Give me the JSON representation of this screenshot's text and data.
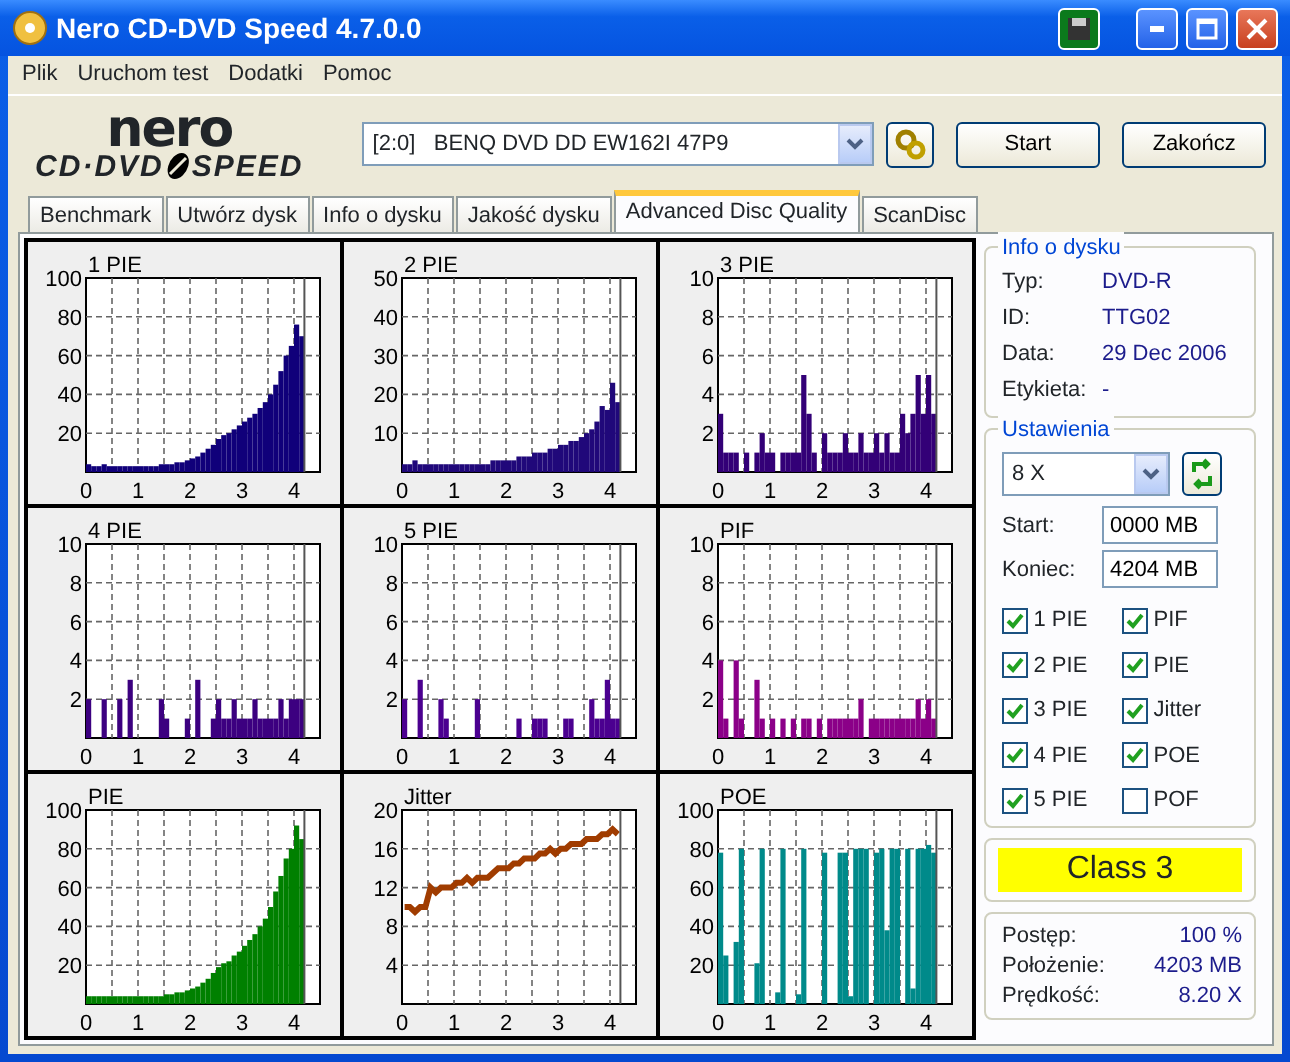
{
  "window": {
    "title": "Nero CD-DVD Speed 4.7.0.0"
  },
  "menu": [
    "Plik",
    "Uruchom test",
    "Dodatki",
    "Pomoc"
  ],
  "logo": {
    "top": "nero",
    "left": "CD·DVD",
    "right": "SPEED"
  },
  "toolbar": {
    "drive": "[2:0]   BENQ DVD DD EW162I 47P9",
    "buttons": [
      "Start",
      "Zakończ"
    ]
  },
  "tabs": [
    {
      "label": "Benchmark",
      "selected": false
    },
    {
      "label": "Utwórz dysk",
      "selected": false
    },
    {
      "label": "Info o dysku",
      "selected": false
    },
    {
      "label": "Jakość dysku",
      "selected": false
    },
    {
      "label": "Advanced Disc Quality",
      "selected": true
    },
    {
      "label": "ScanDisc",
      "selected": false
    }
  ],
  "charts": [
    {
      "chart_data": {
        "type": "bar",
        "grid": true,
        "ref_lines": [
          {
            "axis": "x",
            "value": 4.2
          }
        ],
        "x": [
          0,
          0.1,
          0.2,
          0.3,
          0.4,
          0.5,
          0.6,
          0.7,
          0.8,
          0.9,
          1,
          1.1,
          1.2,
          1.3,
          1.4,
          1.5,
          1.6,
          1.7,
          1.8,
          1.9,
          2,
          2.1,
          2.2,
          2.3,
          2.4,
          2.5,
          2.6,
          2.7,
          2.8,
          2.9,
          3,
          3.1,
          3.2,
          3.3,
          3.4,
          3.5,
          3.6,
          3.7,
          3.8,
          3.9,
          4,
          4.1
        ],
        "series": [
          {
            "name": "1 PIE",
            "color": "#10007a",
            "values": [
              4,
              3,
              3,
              4,
              3,
              3,
              3,
              3,
              3,
              3,
              3,
              3,
              3,
              3,
              4,
              4,
              4,
              5,
              5,
              6,
              7,
              8,
              10,
              12,
              14,
              17,
              19,
              20,
              22,
              24,
              26,
              28,
              30,
              33,
              36,
              40,
              45,
              52,
              60,
              65,
              76,
              70
            ]
          }
        ],
        "xlim": [
          0,
          4.5
        ],
        "ylim": [
          0,
          100
        ],
        "xticks": [
          0,
          1,
          2,
          3,
          4
        ],
        "yticks": [
          20,
          40,
          60,
          80,
          100
        ]
      }
    },
    {
      "chart_data": {
        "type": "bar",
        "grid": true,
        "ref_lines": [
          {
            "axis": "x",
            "value": 4.2
          }
        ],
        "x": [
          0,
          0.1,
          0.2,
          0.3,
          0.4,
          0.5,
          0.6,
          0.7,
          0.8,
          0.9,
          1,
          1.1,
          1.2,
          1.3,
          1.4,
          1.5,
          1.6,
          1.7,
          1.8,
          1.9,
          2,
          2.1,
          2.2,
          2.3,
          2.4,
          2.5,
          2.6,
          2.7,
          2.8,
          2.9,
          3,
          3.1,
          3.2,
          3.3,
          3.4,
          3.5,
          3.6,
          3.7,
          3.8,
          3.9,
          4,
          4.1
        ],
        "series": [
          {
            "name": "2 PIE",
            "color": "#20087a",
            "values": [
              2,
              2,
              3,
              2,
              2,
              2,
              2,
              2,
              2,
              2,
              2,
              2,
              2,
              2,
              2,
              2,
              2,
              3,
              3,
              3,
              3,
              3,
              4,
              4,
              4,
              5,
              5,
              5,
              6,
              6,
              7,
              7,
              8,
              8,
              9,
              10,
              11,
              13,
              17,
              16,
              23,
              18
            ]
          }
        ],
        "xlim": [
          0,
          4.5
        ],
        "ylim": [
          0,
          50
        ],
        "xticks": [
          0,
          1,
          2,
          3,
          4
        ],
        "yticks": [
          10,
          20,
          30,
          40,
          50
        ]
      }
    },
    {
      "chart_data": {
        "type": "bar",
        "grid": true,
        "ref_lines": [
          {
            "axis": "x",
            "value": 4.2
          }
        ],
        "x": [
          0,
          0.1,
          0.2,
          0.3,
          0.4,
          0.5,
          0.6,
          0.7,
          0.8,
          0.9,
          1,
          1.1,
          1.2,
          1.3,
          1.4,
          1.5,
          1.6,
          1.7,
          1.8,
          1.9,
          2,
          2.1,
          2.2,
          2.3,
          2.4,
          2.5,
          2.6,
          2.7,
          2.8,
          2.9,
          3,
          3.1,
          3.2,
          3.3,
          3.4,
          3.5,
          3.6,
          3.7,
          3.8,
          3.9,
          4,
          4.1
        ],
        "series": [
          {
            "name": "3 PIE",
            "color": "#330077",
            "values": [
              3,
              1,
              1,
              1,
              0,
              1,
              0,
              1,
              2,
              1,
              1,
              0,
              1,
              1,
              1,
              1,
              5,
              3,
              1,
              0,
              2,
              1,
              1,
              1,
              2,
              1,
              1,
              2,
              1,
              1,
              2,
              1,
              2,
              1,
              1,
              3,
              2,
              3,
              5,
              3,
              5,
              3
            ]
          }
        ],
        "xlim": [
          0,
          4.5
        ],
        "ylim": [
          0,
          10
        ],
        "xticks": [
          0,
          1,
          2,
          3,
          4
        ],
        "yticks": [
          2,
          4,
          6,
          8,
          10
        ]
      }
    },
    {
      "chart_data": {
        "type": "bar",
        "grid": true,
        "ref_lines": [
          {
            "axis": "x",
            "value": 4.2
          }
        ],
        "x": [
          0,
          0.1,
          0.2,
          0.3,
          0.4,
          0.5,
          0.6,
          0.7,
          0.8,
          0.9,
          1,
          1.1,
          1.2,
          1.3,
          1.4,
          1.5,
          1.6,
          1.7,
          1.8,
          1.9,
          2,
          2.1,
          2.2,
          2.3,
          2.4,
          2.5,
          2.6,
          2.7,
          2.8,
          2.9,
          3,
          3.1,
          3.2,
          3.3,
          3.4,
          3.5,
          3.6,
          3.7,
          3.8,
          3.9,
          4,
          4.1
        ],
        "series": [
          {
            "name": "4 PIE",
            "color": "#3c0080",
            "values": [
              2,
              0,
              0,
              2,
              0,
              0,
              2,
              0,
              3,
              0,
              0,
              0,
              0,
              0,
              2,
              1,
              0,
              0,
              0,
              1,
              0,
              3,
              0,
              0,
              1,
              2,
              1,
              1,
              2,
              1,
              1,
              1,
              2,
              1,
              1,
              1,
              1,
              2,
              1,
              2,
              2,
              2
            ]
          }
        ],
        "xlim": [
          0,
          4.5
        ],
        "ylim": [
          0,
          10
        ],
        "xticks": [
          0,
          1,
          2,
          3,
          4
        ],
        "yticks": [
          2,
          4,
          6,
          8,
          10
        ]
      }
    },
    {
      "chart_data": {
        "type": "bar",
        "grid": true,
        "ref_lines": [
          {
            "axis": "x",
            "value": 4.2
          }
        ],
        "x": [
          0,
          0.1,
          0.2,
          0.3,
          0.4,
          0.5,
          0.6,
          0.7,
          0.8,
          0.9,
          1,
          1.1,
          1.2,
          1.3,
          1.4,
          1.5,
          1.6,
          1.7,
          1.8,
          1.9,
          2,
          2.1,
          2.2,
          2.3,
          2.4,
          2.5,
          2.6,
          2.7,
          2.8,
          2.9,
          3,
          3.1,
          3.2,
          3.3,
          3.4,
          3.5,
          3.6,
          3.7,
          3.8,
          3.9,
          4,
          4.1
        ],
        "series": [
          {
            "name": "5 PIE",
            "color": "#4b0090",
            "values": [
              2,
              0,
              0,
              3,
              0,
              0,
              0,
              2,
              1,
              0,
              0,
              0,
              0,
              0,
              2,
              0,
              0,
              0,
              0,
              0,
              0,
              0,
              1,
              0,
              0,
              1,
              1,
              1,
              0,
              0,
              0,
              1,
              1,
              0,
              0,
              0,
              2,
              1,
              1,
              3,
              1,
              1
            ]
          }
        ],
        "xlim": [
          0,
          4.5
        ],
        "ylim": [
          0,
          10
        ],
        "xticks": [
          0,
          1,
          2,
          3,
          4
        ],
        "yticks": [
          2,
          4,
          6,
          8,
          10
        ]
      }
    },
    {
      "chart_data": {
        "type": "bar",
        "grid": true,
        "ref_lines": [
          {
            "axis": "x",
            "value": 4.2
          }
        ],
        "x": [
          0,
          0.1,
          0.2,
          0.3,
          0.4,
          0.5,
          0.6,
          0.7,
          0.8,
          0.9,
          1,
          1.1,
          1.2,
          1.3,
          1.4,
          1.5,
          1.6,
          1.7,
          1.8,
          1.9,
          2,
          2.1,
          2.2,
          2.3,
          2.4,
          2.5,
          2.6,
          2.7,
          2.8,
          2.9,
          3,
          3.1,
          3.2,
          3.3,
          3.4,
          3.5,
          3.6,
          3.7,
          3.8,
          3.9,
          4,
          4.1
        ],
        "series": [
          {
            "name": "PIF",
            "color": "#8b0088",
            "values": [
              4,
              1,
              0,
              4,
              1,
              0,
              0,
              3,
              1,
              0,
              1,
              0,
              1,
              0,
              1,
              0,
              1,
              1,
              0,
              1,
              0,
              1,
              1,
              1,
              1,
              1,
              1,
              2,
              0,
              1,
              1,
              1,
              1,
              1,
              1,
              1,
              1,
              1,
              2,
              1,
              2,
              1
            ]
          }
        ],
        "xlim": [
          0,
          4.5
        ],
        "ylim": [
          0,
          10
        ],
        "xticks": [
          0,
          1,
          2,
          3,
          4
        ],
        "yticks": [
          2,
          4,
          6,
          8,
          10
        ]
      }
    },
    {
      "chart_data": {
        "type": "bar",
        "grid": true,
        "ref_lines": [
          {
            "axis": "x",
            "value": 4.2
          }
        ],
        "x": [
          0,
          0.1,
          0.2,
          0.3,
          0.4,
          0.5,
          0.6,
          0.7,
          0.8,
          0.9,
          1,
          1.1,
          1.2,
          1.3,
          1.4,
          1.5,
          1.6,
          1.7,
          1.8,
          1.9,
          2,
          2.1,
          2.2,
          2.3,
          2.4,
          2.5,
          2.6,
          2.7,
          2.8,
          2.9,
          3,
          3.1,
          3.2,
          3.3,
          3.4,
          3.5,
          3.6,
          3.7,
          3.8,
          3.9,
          4,
          4.1
        ],
        "series": [
          {
            "name": "PIE",
            "color": "#008000",
            "values": [
              4,
              4,
              4,
              4,
              4,
              4,
              4,
              4,
              4,
              4,
              4,
              4,
              4,
              4,
              4,
              5,
              5,
              6,
              6,
              7,
              8,
              9,
              11,
              13,
              16,
              19,
              21,
              22,
              25,
              27,
              30,
              33,
              36,
              40,
              44,
              50,
              58,
              66,
              75,
              80,
              92,
              85
            ]
          }
        ],
        "xlim": [
          0,
          4.5
        ],
        "ylim": [
          0,
          100
        ],
        "xticks": [
          0,
          1,
          2,
          3,
          4
        ],
        "yticks": [
          20,
          40,
          60,
          80,
          100
        ]
      }
    },
    {
      "chart_data": {
        "type": "line",
        "grid": true,
        "ref_lines": [
          {
            "axis": "x",
            "value": 4.2
          }
        ],
        "x": [
          0,
          0.1,
          0.2,
          0.3,
          0.4,
          0.5,
          0.6,
          0.7,
          0.8,
          0.9,
          1,
          1.1,
          1.2,
          1.3,
          1.4,
          1.5,
          1.6,
          1.7,
          1.8,
          1.9,
          2,
          2.1,
          2.2,
          2.3,
          2.4,
          2.5,
          2.6,
          2.7,
          2.8,
          2.9,
          3,
          3.1,
          3.2,
          3.3,
          3.4,
          3.5,
          3.6,
          3.7,
          3.8,
          3.9,
          4,
          4.1
        ],
        "series": [
          {
            "name": "Jitter",
            "color": "#a03c00",
            "values": [
              10,
              10,
              9.5,
              10,
              10,
              12,
              11.5,
              12,
              12,
              12,
              12.5,
              12.5,
              13,
              12.5,
              13,
              13,
              13,
              13.5,
              14,
              14,
              14,
              14.5,
              14.5,
              15,
              15,
              15,
              15.5,
              15.5,
              16,
              15.5,
              16,
              16,
              16.5,
              16.5,
              16.5,
              17,
              17,
              17,
              17.5,
              17.5,
              18,
              17.5
            ]
          }
        ],
        "xlim": [
          0,
          4.5
        ],
        "ylim": [
          0,
          20
        ],
        "xticks": [
          0,
          1,
          2,
          3,
          4
        ],
        "yticks": [
          4,
          8,
          12,
          16,
          20
        ]
      }
    },
    {
      "chart_data": {
        "type": "bar",
        "grid": true,
        "ref_lines": [
          {
            "axis": "x",
            "value": 4.2
          }
        ],
        "x": [
          0,
          0.1,
          0.2,
          0.3,
          0.4,
          0.5,
          0.6,
          0.7,
          0.8,
          0.9,
          1,
          1.1,
          1.2,
          1.3,
          1.4,
          1.5,
          1.6,
          1.7,
          1.8,
          1.9,
          2,
          2.1,
          2.2,
          2.3,
          2.4,
          2.5,
          2.6,
          2.7,
          2.8,
          2.9,
          3,
          3.1,
          3.2,
          3.3,
          3.4,
          3.5,
          3.6,
          3.7,
          3.8,
          3.9,
          4,
          4.1
        ],
        "series": [
          {
            "name": "POE",
            "color": "#008a8a",
            "values": [
              78,
              25,
              0,
              32,
              80,
              0,
              0,
              21,
              80,
              0,
              0,
              6,
              80,
              0,
              0,
              5,
              80,
              0,
              0,
              0,
              78,
              0,
              0,
              78,
              78,
              4,
              80,
              80,
              80,
              0,
              78,
              80,
              38,
              80,
              80,
              0,
              80,
              8,
              80,
              80,
              82,
              78
            ]
          }
        ],
        "xlim": [
          0,
          4.5
        ],
        "ylim": [
          0,
          100
        ],
        "xticks": [
          0,
          1,
          2,
          3,
          4
        ],
        "yticks": [
          20,
          40,
          60,
          80,
          100
        ]
      }
    }
  ],
  "disc_info": {
    "title": "Info o dysku",
    "fields": [
      {
        "label": "Typ:",
        "value": "DVD-R"
      },
      {
        "label": "ID:",
        "value": "TTG02"
      },
      {
        "label": "Data:",
        "value": "29 Dec 2006"
      },
      {
        "label": "Etykieta:",
        "value": "-"
      }
    ]
  },
  "settings": {
    "title": "Ustawienia",
    "speed": "8 X",
    "start_label": "Start:",
    "start": "0000 MB",
    "end_label": "Koniec:",
    "end": "4204 MB",
    "checks": [
      {
        "label": "1 PIE",
        "checked": true
      },
      {
        "label": "PIF",
        "checked": true
      },
      {
        "label": "2 PIE",
        "checked": true
      },
      {
        "label": "PIE",
        "checked": true
      },
      {
        "label": "3 PIE",
        "checked": true
      },
      {
        "label": "Jitter",
        "checked": true
      },
      {
        "label": "4 PIE",
        "checked": true
      },
      {
        "label": "POE",
        "checked": true
      },
      {
        "label": "5 PIE",
        "checked": true
      },
      {
        "label": "POF",
        "checked": false
      }
    ]
  },
  "quality_class": "Class 3",
  "progress": [
    {
      "label": "Postęp:",
      "value": "100 %"
    },
    {
      "label": "Położenie:",
      "value": "4203 MB"
    },
    {
      "label": "Prędkość:",
      "value": "8.20 X"
    }
  ]
}
